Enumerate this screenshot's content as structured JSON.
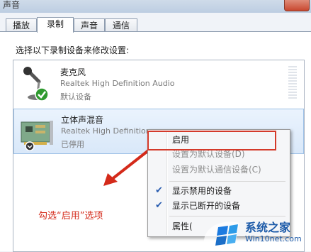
{
  "window": {
    "title": "声音"
  },
  "tabs": [
    {
      "label": "播放"
    },
    {
      "label": "录制"
    },
    {
      "label": "声音"
    },
    {
      "label": "通信"
    }
  ],
  "instruction": "选择以下录制设备来修改设置:",
  "devices": [
    {
      "name": "麦克风",
      "description": "Realtek High Definition Audio",
      "status": "默认设备",
      "icon": "microphone-icon"
    },
    {
      "name": "立体声混音",
      "description": "Realtek High Definition",
      "status": "已停用",
      "icon": "sound-card-icon"
    }
  ],
  "context_menu": {
    "items": [
      {
        "label": "启用"
      },
      {
        "label": "设置为默认设备(D)"
      },
      {
        "label": "设置为默认通信设备(C)"
      },
      {
        "label": "显示禁用的设备",
        "checked": true
      },
      {
        "label": "显示已断开的设备",
        "checked": true
      },
      {
        "label": "属性("
      }
    ]
  },
  "annotation": "勾选“启用”选项",
  "watermark": {
    "title": "系统之家",
    "url": "Win10net.com"
  },
  "colors": {
    "annotation": "#d42a1a",
    "selection": "#d9e8f9",
    "highlight_box": "#d43a2a"
  }
}
